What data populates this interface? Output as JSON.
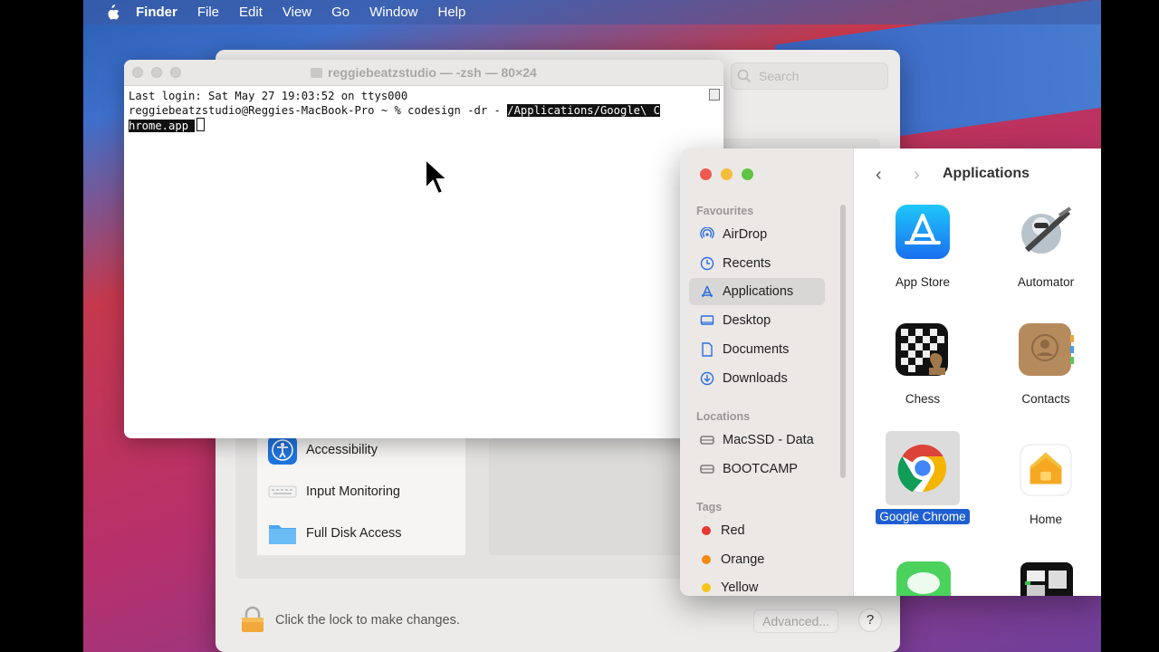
{
  "menubar": {
    "app_name": "Finder",
    "items": [
      "File",
      "Edit",
      "View",
      "Go",
      "Window",
      "Help"
    ]
  },
  "security_window": {
    "search_placeholder": "Search",
    "privacy_items": [
      {
        "label": "Accessibility",
        "icon": "accessibility-icon"
      },
      {
        "label": "Input Monitoring",
        "icon": "keyboard-icon"
      },
      {
        "label": "Full Disk Access",
        "icon": "folder-icon"
      }
    ],
    "lock_text": "Click the lock to make changes.",
    "advanced_label": "Advanced...",
    "help_label": "?"
  },
  "terminal": {
    "title": "reggiebeatzstudio — -zsh — 80×24",
    "line1": "Last login: Sat May 27 19:03:52 on ttys000",
    "prompt": "reggiebeatzstudio@Reggies-MacBook-Pro ~ % codesign -dr - ",
    "selected_part1": "/Applications/Google\\ C",
    "selected_part2": "hrome.app"
  },
  "finder": {
    "title": "Applications",
    "favourites_header": "Favourites",
    "favourites": [
      {
        "label": "AirDrop",
        "icon": "airdrop-icon"
      },
      {
        "label": "Recents",
        "icon": "clock-icon"
      },
      {
        "label": "Applications",
        "icon": "applications-icon",
        "active": true
      },
      {
        "label": "Desktop",
        "icon": "desktop-icon"
      },
      {
        "label": "Documents",
        "icon": "document-icon"
      },
      {
        "label": "Downloads",
        "icon": "download-icon"
      }
    ],
    "locations_header": "Locations",
    "locations": [
      {
        "label": "MacSSD - Data",
        "icon": "disk-icon"
      },
      {
        "label": "BOOTCAMP",
        "icon": "disk-icon"
      }
    ],
    "tags_header": "Tags",
    "tags": [
      {
        "label": "Red",
        "color": "#e8372f"
      },
      {
        "label": "Orange",
        "color": "#f28a17"
      },
      {
        "label": "Yellow",
        "color": "#f5c518"
      }
    ],
    "apps": [
      {
        "label": "App Store",
        "icon": "app-store-icon"
      },
      {
        "label": "Automator",
        "icon": "automator-icon"
      },
      {
        "label": "Chess",
        "icon": "chess-icon"
      },
      {
        "label": "Contacts",
        "icon": "contacts-icon"
      },
      {
        "label": "Google Chrome",
        "icon": "chrome-icon",
        "selected": true
      },
      {
        "label": "Home",
        "icon": "home-icon"
      }
    ]
  }
}
